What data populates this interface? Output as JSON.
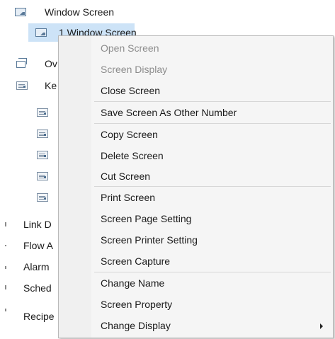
{
  "tree": {
    "root_label": "Window Screen",
    "selected_label": "1 Window Screen",
    "ov_label": "Ov",
    "ke_label": "Ke",
    "link_label": "Link D",
    "flow_label": "Flow A",
    "alarm_label": "Alarm",
    "sched_label": "Sched",
    "recipe_label": "Recipe"
  },
  "context_menu": {
    "items": [
      {
        "label": "Open Screen",
        "enabled": false
      },
      {
        "label": "Screen Display",
        "enabled": false
      },
      {
        "label": "Close Screen",
        "enabled": true
      },
      {
        "label": "Save Screen As Other Number",
        "enabled": true
      },
      {
        "label": "Copy Screen",
        "enabled": true
      },
      {
        "label": "Delete Screen",
        "enabled": true
      },
      {
        "label": "Cut Screen",
        "enabled": true
      },
      {
        "label": "Print Screen",
        "enabled": true
      },
      {
        "label": "Screen Page Setting",
        "enabled": true
      },
      {
        "label": "Screen Printer Setting",
        "enabled": true
      },
      {
        "label": "Screen Capture",
        "enabled": true
      },
      {
        "label": "Change Name",
        "enabled": true
      },
      {
        "label": "Screen Property",
        "enabled": true
      },
      {
        "label": "Change Display",
        "enabled": true
      }
    ]
  }
}
